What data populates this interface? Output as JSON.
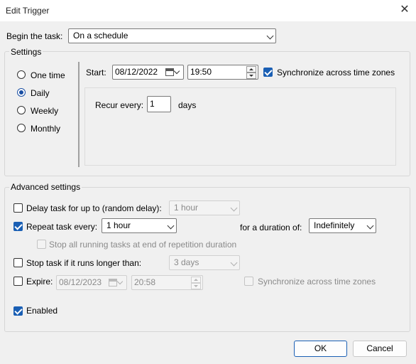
{
  "window": {
    "title": "Edit Trigger",
    "close_glyph": "✕"
  },
  "begin": {
    "label": "Begin the task:",
    "value": "On a schedule"
  },
  "settings": {
    "legend": "Settings",
    "radios": [
      {
        "label": "One time",
        "selected": false
      },
      {
        "label": "Daily",
        "selected": true
      },
      {
        "label": "Weekly",
        "selected": false
      },
      {
        "label": "Monthly",
        "selected": false
      }
    ],
    "start_label": "Start:",
    "start_date": "08/12/2022",
    "start_time": "19:50",
    "sync_label": "Synchronize across time zones",
    "recur_label": "Recur every:",
    "recur_value": "1",
    "recur_unit": "days"
  },
  "advanced": {
    "legend": "Advanced settings",
    "delay_label": "Delay task for up to (random delay):",
    "delay_value": "1 hour",
    "repeat_label": "Repeat task every:",
    "repeat_value": "1 hour",
    "duration_label": "for a duration of:",
    "duration_value": "Indefinitely",
    "stop_all_label": "Stop all running tasks at end of repetition duration",
    "stop_longer_label": "Stop task if it runs longer than:",
    "stop_longer_value": "3 days",
    "expire_label": "Expire:",
    "expire_date": "08/12/2023",
    "expire_time": "20:58",
    "expire_sync_label": "Synchronize across time zones",
    "enabled_label": "Enabled"
  },
  "buttons": {
    "ok": "OK",
    "cancel": "Cancel"
  }
}
